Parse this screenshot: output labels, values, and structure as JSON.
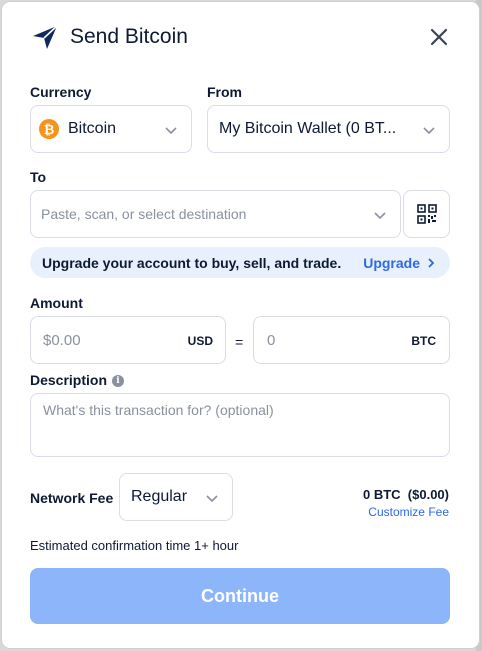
{
  "dialog": {
    "title": "Send Bitcoin"
  },
  "currency": {
    "label": "Currency",
    "value": "Bitcoin",
    "coin_glyph": "₿",
    "coin_color": "#f7931a"
  },
  "from": {
    "label": "From",
    "value": "My Bitcoin Wallet (0 BT..."
  },
  "to": {
    "label": "To",
    "placeholder": "Paste, scan, or select destination"
  },
  "upgrade": {
    "text": "Upgrade your account to buy, sell, and trade.",
    "link": "Upgrade"
  },
  "amount": {
    "label": "Amount",
    "fiat_placeholder": "$0.00",
    "fiat_unit": "USD",
    "equals": "=",
    "crypto_placeholder": "0",
    "crypto_unit": "BTC"
  },
  "description": {
    "label": "Description",
    "info_glyph": "i",
    "placeholder": "What's this transaction for? (optional)"
  },
  "network_fee": {
    "label": "Network Fee",
    "value": "Regular",
    "amount": "0 BTC  ($0.00)",
    "customize_link": "Customize Fee"
  },
  "estimate": "Estimated confirmation time 1+ hour",
  "continue_label": "Continue",
  "colors": {
    "accent": "#2d6ae3",
    "button_disabled": "#8db5fa",
    "banner_bg": "#e8f0fd",
    "text": "#0e1a33"
  }
}
